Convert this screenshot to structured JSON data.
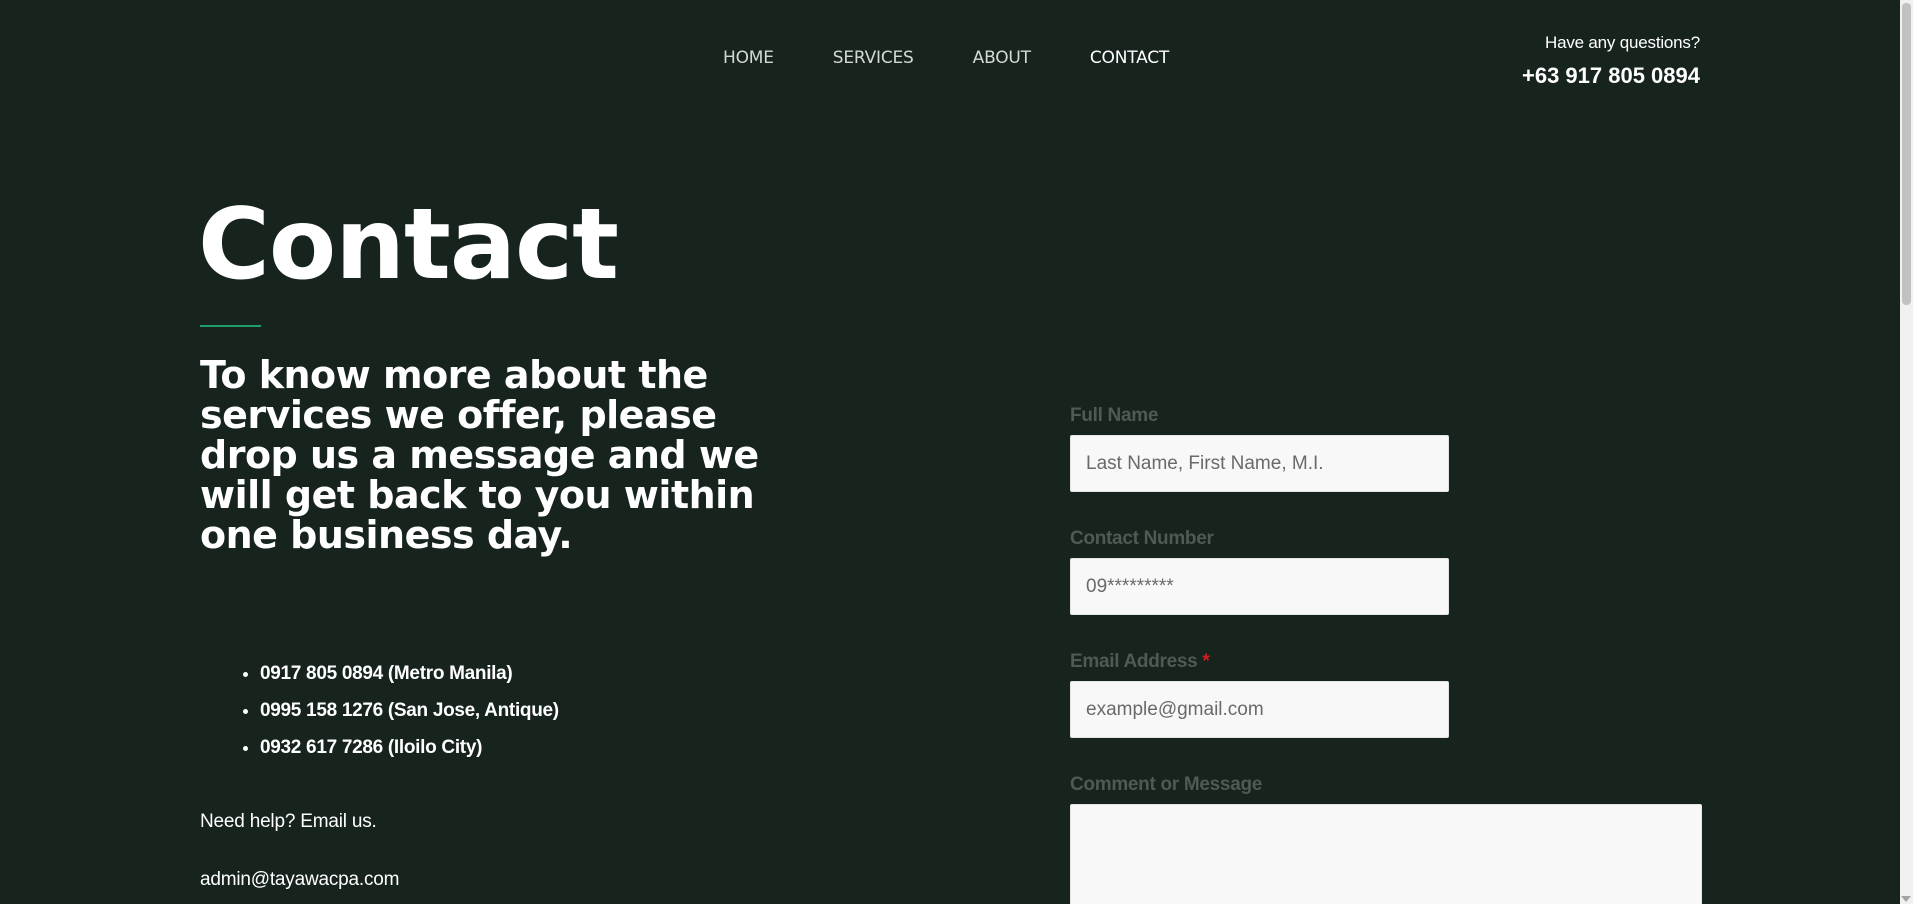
{
  "nav": {
    "items": [
      {
        "label": "HOME"
      },
      {
        "label": "SERVICES"
      },
      {
        "label": "ABOUT"
      },
      {
        "label": "CONTACT"
      }
    ],
    "active": "CONTACT"
  },
  "header": {
    "questions_label": "Have any questions?",
    "phone": "+63 917 805 0894"
  },
  "main": {
    "title": "Contact",
    "lead": "To know more about the services we offer, please drop us a message and we will get back to you within one business day.",
    "phones": [
      "0917 805 0894 (Metro Manila)",
      "0995 158 1276 (San Jose, Antique)",
      "0932 617 7286 (Iloilo City)"
    ],
    "help_text": "Need help? Email us.",
    "email": "admin@tayawacpa.com"
  },
  "form": {
    "full_name": {
      "label": "Full Name",
      "placeholder": "Last Name, First Name, M.I."
    },
    "contact_number": {
      "label": "Contact Number",
      "placeholder": "09*********"
    },
    "email": {
      "label": "Email Address",
      "required_mark": "*",
      "placeholder": "example@gmail.com"
    },
    "message": {
      "label": "Comment or Message"
    }
  },
  "colors": {
    "background": "#17231d",
    "accent": "#1f9e6a",
    "required": "#d21d1d"
  }
}
